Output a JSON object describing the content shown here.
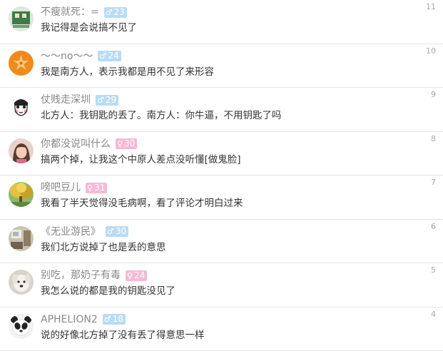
{
  "comments": [
    {
      "name": "不瘦就死：=",
      "gender": "♂",
      "age": "23",
      "text": "我记得是会说搞不见了",
      "floor": "11",
      "avatar": "pixel-art-avatar",
      "badge_color": "#b9dcf5"
    },
    {
      "name": "～～no～～",
      "gender": "♂",
      "age": "24",
      "text": "我是南方人，表示我都是用不见了来形容",
      "floor": "10",
      "avatar": "starfish-avatar",
      "badge_color": "#b9dcf5"
    },
    {
      "name": "仗贱走深圳",
      "gender": "♂",
      "age": "29",
      "text": "北方人：我钥匙的丢了。南方人：你牛逼，不用钥匙了吗",
      "floor": "9",
      "avatar": "cartoon-face-avatar",
      "badge_color": "#b9dcf5"
    },
    {
      "name": "你都没说叫什么",
      "gender": "♀",
      "age": "30",
      "text": "搞两个掉，让我这个中原人差点没听懂[做鬼脸]",
      "floor": "8",
      "avatar": "woman-photo-avatar",
      "badge_color": "#f6b9d6"
    },
    {
      "name": "嗙吧豆儿",
      "gender": "♀",
      "age": "31",
      "text": "我看了半天觉得没毛病啊，看了评论才明白过来",
      "floor": "7",
      "avatar": "tree-photo-avatar",
      "badge_color": "#f6b9d6"
    },
    {
      "name": "《无业游民》",
      "gender": "♂",
      "age": "30",
      "text": "我们北方说掉了也是丢的意思",
      "floor": "6",
      "avatar": "room-photo-avatar",
      "badge_color": "#b9dcf5"
    },
    {
      "name": "别吃，那奶子有毒",
      "gender": "♀",
      "age": "24",
      "text": "我怎么说的都是我的钥匙没见了",
      "floor": "5",
      "avatar": "dog-photo-avatar",
      "badge_color": "#f6b9d6"
    },
    {
      "name": "APHELION2",
      "gender": "♂",
      "age": "18",
      "text": "说的好像北方掉了没有丢了得意思一样",
      "floor": "4",
      "avatar": "panda-avatar",
      "badge_color": "#b9dcf5"
    }
  ]
}
